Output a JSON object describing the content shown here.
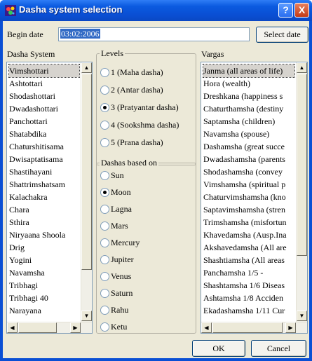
{
  "window": {
    "title": "Dasha system selection",
    "help_label": "?",
    "close_label": "X"
  },
  "begin_date": {
    "label": "Begin date",
    "value": "03:02:2006",
    "select_button": "Select date"
  },
  "dasha_system": {
    "label": "Dasha System",
    "selected_index": 0,
    "items": [
      "Vimshottari",
      "Ashtottari",
      "Shodashottari",
      "Dwadashottari",
      "Panchottari",
      "Shatabdika",
      "Chaturshitisama",
      "Dwisaptatisama",
      "Shastihayani",
      "Shattrimshatsam",
      "Kalachakra",
      "Chara",
      "Sthira",
      "Niryaana Shoola",
      "Drig",
      "Yogini",
      "Navamsha",
      "Tribhagi",
      "Tribhagi 40",
      "Narayana"
    ]
  },
  "levels": {
    "label": "Levels",
    "selected_index": 2,
    "options": [
      "1 (Maha dasha)",
      "2 (Antar dasha)",
      "3 (Pratyantar dasha)",
      "4 (Sookshma dasha)",
      "5 (Prana dasha)"
    ]
  },
  "based_on": {
    "label": "Dashas based on",
    "selected_index": 1,
    "options": [
      "Sun",
      "Moon",
      "Lagna",
      "Mars",
      "Mercury",
      "Jupiter",
      "Venus",
      "Saturn",
      "Rahu",
      "Ketu"
    ]
  },
  "vargas": {
    "label": "Vargas",
    "selected_index": 0,
    "items": [
      "Janma  (all areas of life)",
      "Hora  (wealth)",
      "Dreshkana  (happiness s",
      "Chaturthamsha  (destiny",
      "Saptamsha  (children)",
      "Navamsha  (spouse)",
      "Dashamsha  (great succe",
      "Dwadashamsha  (parents",
      "Shodashamsha  (convey",
      "Vimshamsha  (spiritual p",
      "Chaturvimshamsha  (kno",
      "Saptavimshamsha  (stren",
      "Trimshamsha  (misfortun",
      "Khavedamsha  (Ausp.Ina",
      "Akshavedamsha  (All are",
      "Shashtiamsha  (All areas",
      "Panchamsha 1/5  -",
      "Shashtamsha 1/6  Diseas",
      "Ashtamsha 1/8  Acciden",
      "Ekadashamsha 1/11  Cur"
    ]
  },
  "footer": {
    "ok_label": "OK",
    "cancel_label": "Cancel"
  },
  "colors": {
    "title_bar": "#0a4fd4",
    "dialog_bg": "#ece9d8",
    "selection": "#316ac5"
  }
}
